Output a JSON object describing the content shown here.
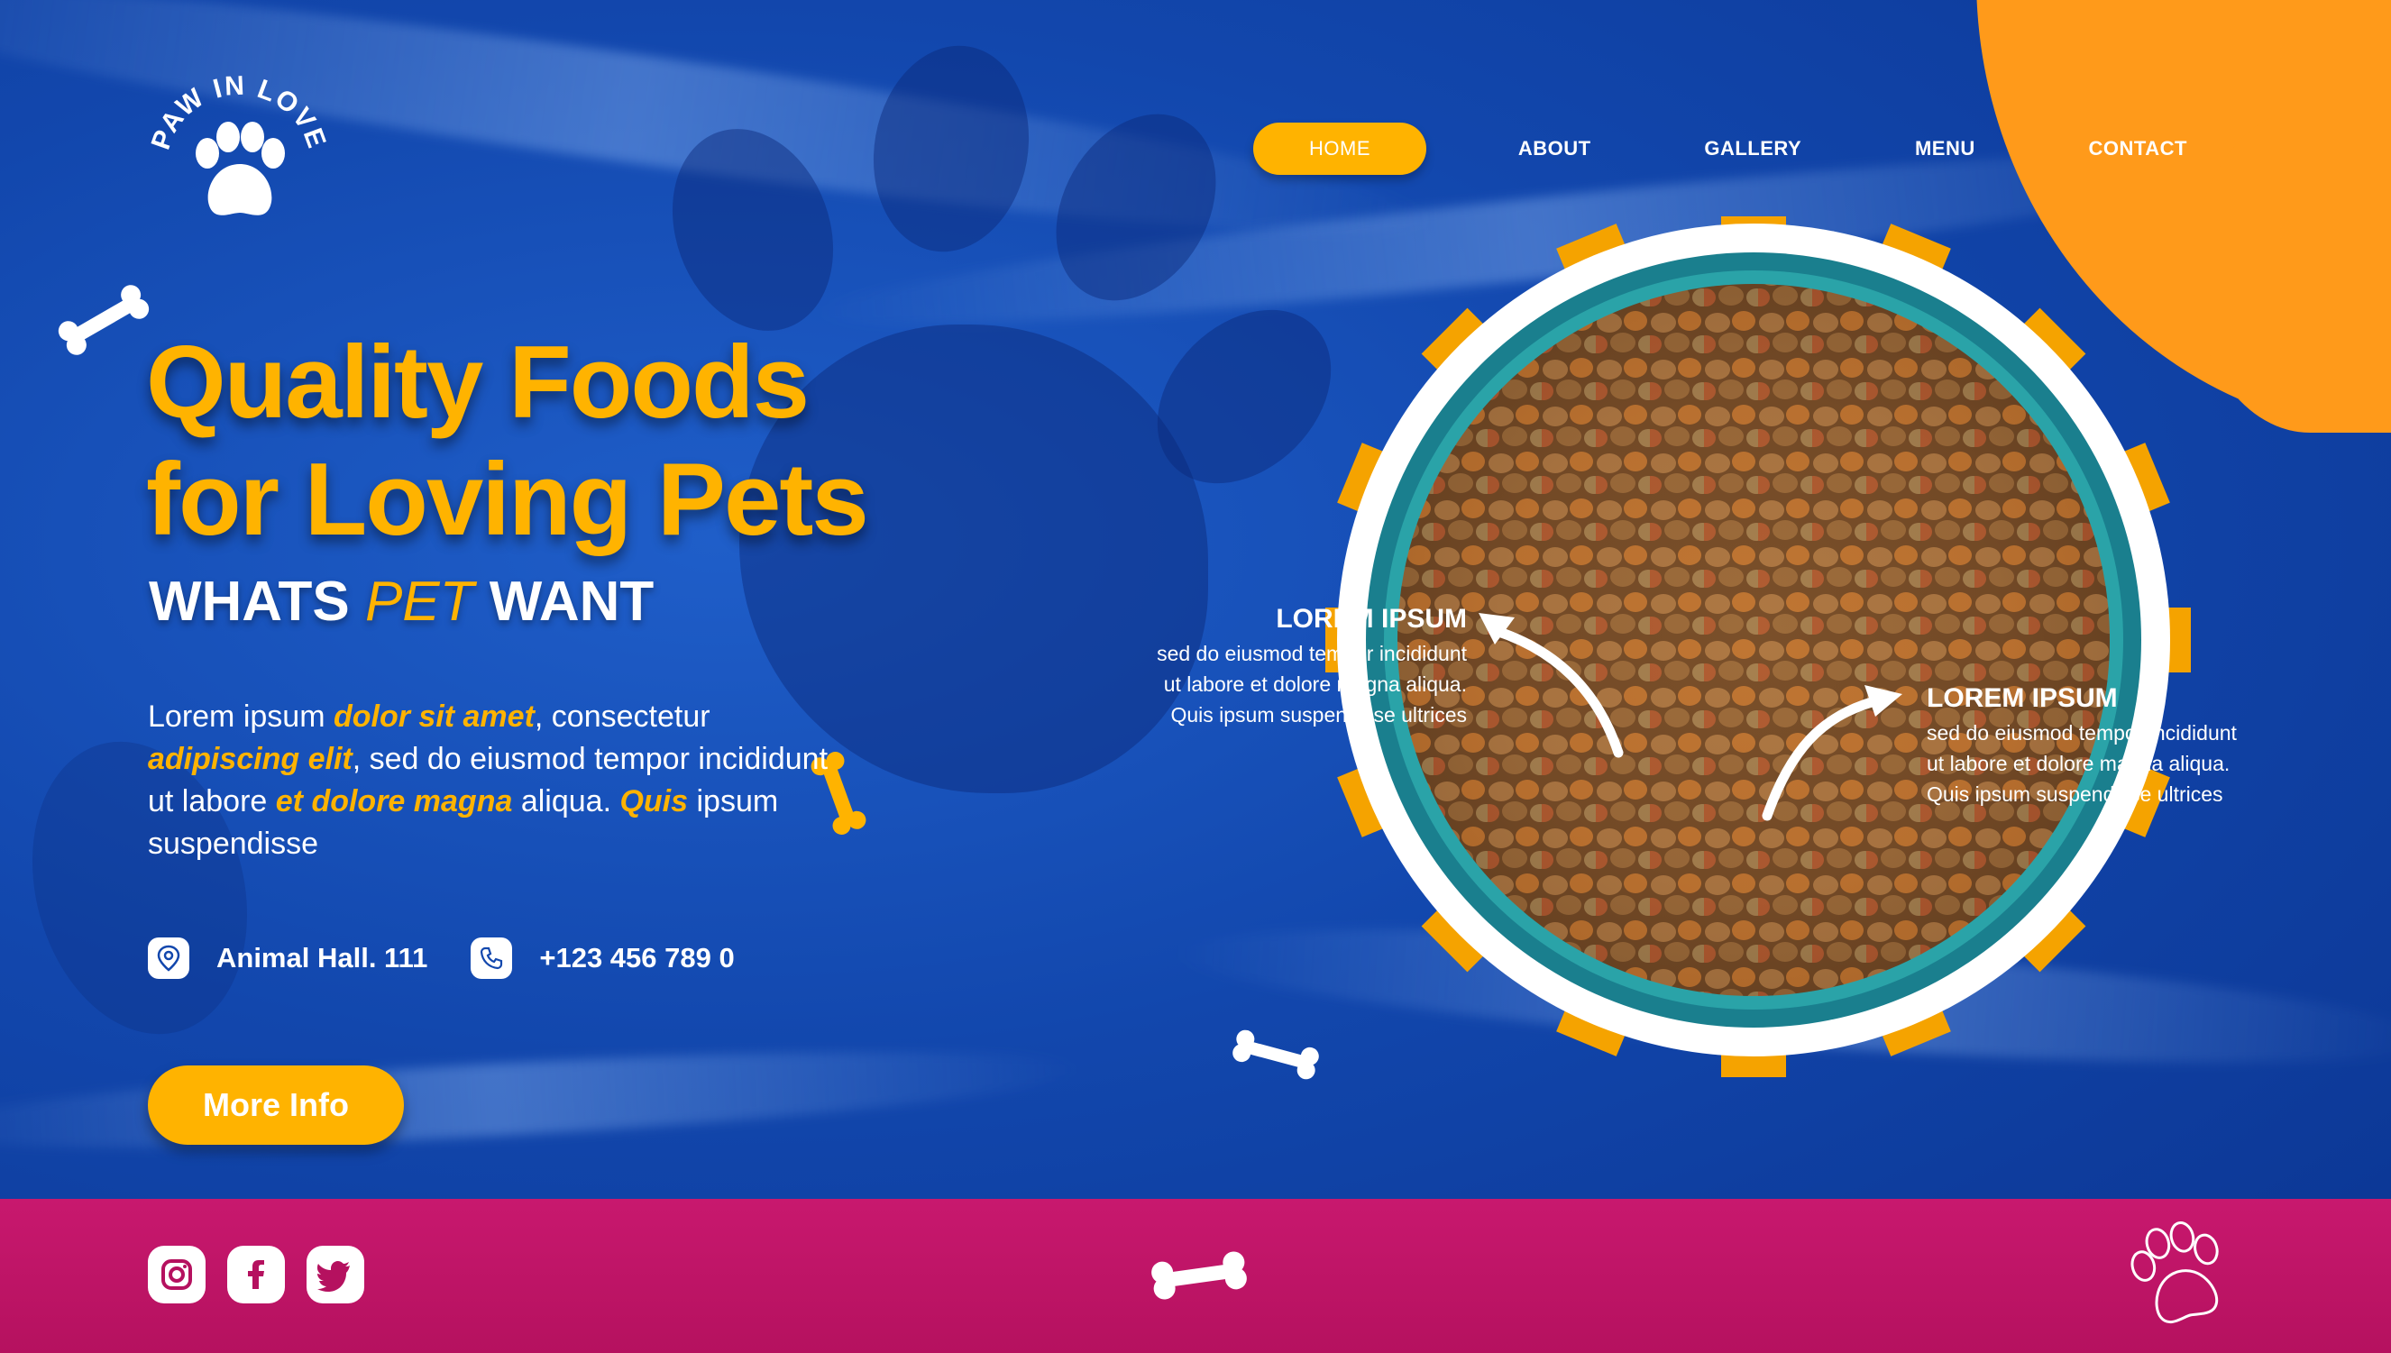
{
  "brand": {
    "logo_text": "PAW IN LOVE"
  },
  "nav": {
    "items": [
      {
        "label": "HOME",
        "active": true
      },
      {
        "label": "ABOUT",
        "active": false
      },
      {
        "label": "GALLERY",
        "active": false
      },
      {
        "label": "MENU",
        "active": false
      },
      {
        "label": "CONTACT",
        "active": false
      }
    ]
  },
  "hero": {
    "headline_line1": "Quality Foods",
    "headline_line2": "for Loving Pets",
    "sub_part1": "WHATS",
    "sub_highlight": "PET",
    "sub_part2": "WANT",
    "para": {
      "t1": "Lorem ipsum ",
      "h1": "dolor sit amet",
      "t2": ", consectetur ",
      "h2": "adipiscing elit",
      "t3": ", sed do eiusmod tempor incididunt ut labore ",
      "h3": "et dolore magna",
      "t4": " aliqua. ",
      "h4": "Quis",
      "t5": " ipsum suspendisse"
    },
    "address": "Animal Hall. 111",
    "phone": "+123 456 789 0",
    "cta_label": "More Info"
  },
  "callouts": [
    {
      "title": "LOREM IPSUM",
      "lines": [
        "sed do eiusmod tempor incididunt",
        "ut labore et dolore magna aliqua.",
        "Quis ipsum suspendisse ultrices"
      ]
    },
    {
      "title": "LOREM IPSUM",
      "lines": [
        "sed do eiusmod tempor incididunt",
        "ut labore et dolore magna aliqua.",
        "Quis ipsum suspendisse ultrices"
      ]
    }
  ],
  "colors": {
    "accent": "#ffb300",
    "background": "#1247ad",
    "footer": "#c8186e",
    "blob": "#ff9a1a"
  },
  "icons": {
    "location": "location-pin-icon",
    "phone": "phone-icon",
    "social": [
      "instagram-icon",
      "facebook-icon",
      "twitter-icon"
    ]
  }
}
